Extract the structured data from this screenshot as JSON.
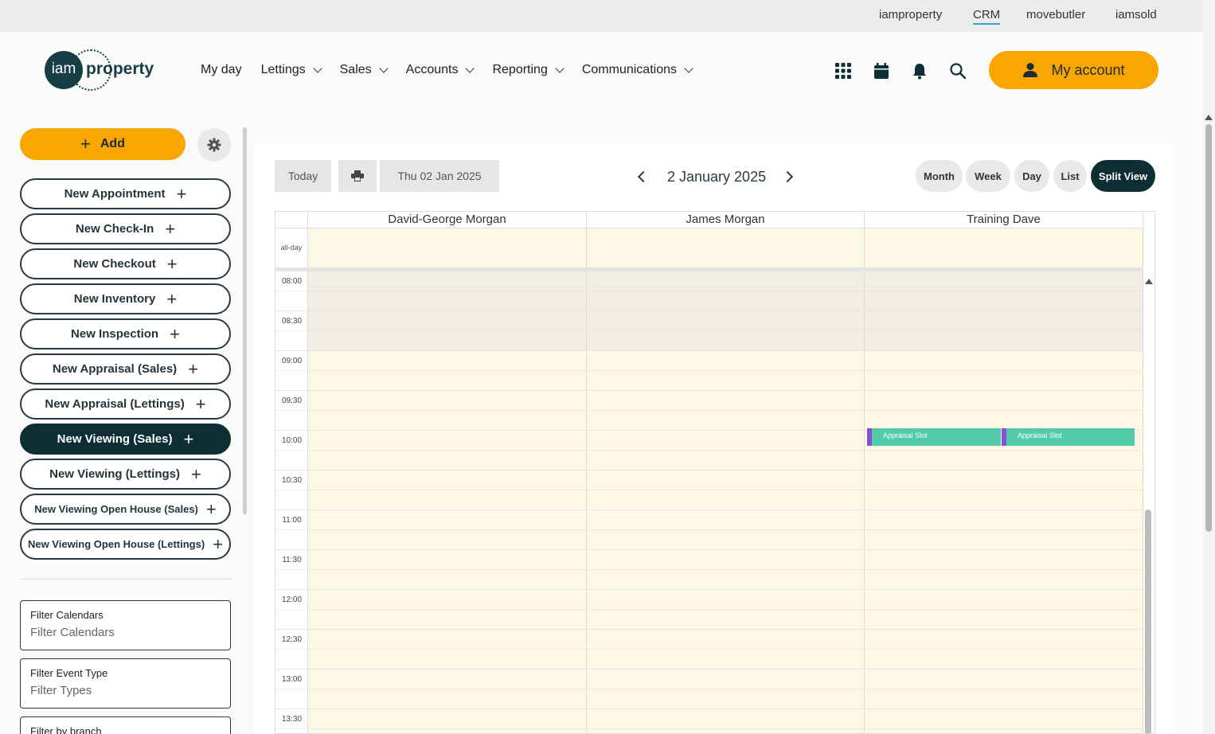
{
  "topbar": {
    "links": [
      "iamproperty",
      "CRM",
      "movebutler",
      "iamsold"
    ],
    "active": "CRM"
  },
  "logo": {
    "circle_text": "iam",
    "text": "property"
  },
  "nav": [
    {
      "label": "My day",
      "dropdown": false
    },
    {
      "label": "Lettings",
      "dropdown": true
    },
    {
      "label": "Sales",
      "dropdown": true
    },
    {
      "label": "Accounts",
      "dropdown": true
    },
    {
      "label": "Reporting",
      "dropdown": true
    },
    {
      "label": "Communications",
      "dropdown": true
    }
  ],
  "header_icons": [
    "apps-grid-icon",
    "calendar-icon",
    "bell-icon",
    "search-icon"
  ],
  "account": {
    "label": "My account"
  },
  "sidebar": {
    "add_label": "Add",
    "actions": [
      {
        "label": "New Appointment"
      },
      {
        "label": "New Check-In"
      },
      {
        "label": "New Checkout"
      },
      {
        "label": "New Inventory"
      },
      {
        "label": "New Inspection"
      },
      {
        "label": "New Appraisal (Sales)"
      },
      {
        "label": "New Appraisal (Lettings)"
      },
      {
        "label": "New Viewing (Sales)",
        "active": true
      },
      {
        "label": "New Viewing (Lettings)"
      },
      {
        "label": "New Viewing Open House (Sales)"
      },
      {
        "label": "New Viewing Open House (Lettings)"
      }
    ],
    "filters": [
      {
        "label": "Filter Calendars",
        "placeholder": "Filter Calendars"
      },
      {
        "label": "Filter Event Type",
        "placeholder": "Filter Types"
      },
      {
        "label": "Filter by branch",
        "placeholder": ""
      }
    ]
  },
  "toolbar": {
    "today": "Today",
    "date_input": "Thu 02 Jan 2025",
    "title": "2 January 2025",
    "views": [
      "Month",
      "Week",
      "Day",
      "List",
      "Split View"
    ],
    "active_view": "Split View"
  },
  "calendar": {
    "resources": [
      "David-George Morgan",
      "James Morgan",
      "Training Dave"
    ],
    "allday_label": "all-day",
    "times": [
      "08:00",
      "08:30",
      "09:00",
      "09:30",
      "10:00",
      "10:30",
      "11:00",
      "11:30",
      "12:00",
      "12:30",
      "13:00",
      "13:30"
    ],
    "events": [
      {
        "title": "Appraisal Slot",
        "resource": "Training Dave",
        "start": "10:00"
      },
      {
        "title": "Appraisal Slot",
        "resource": "Training Dave",
        "start": "10:00"
      }
    ]
  },
  "colors": {
    "accent": "#f9a600",
    "dark": "#0e2e35",
    "event": "#52cba8",
    "event_border": "#8a4fd8",
    "cell": "#fdf7e6"
  }
}
